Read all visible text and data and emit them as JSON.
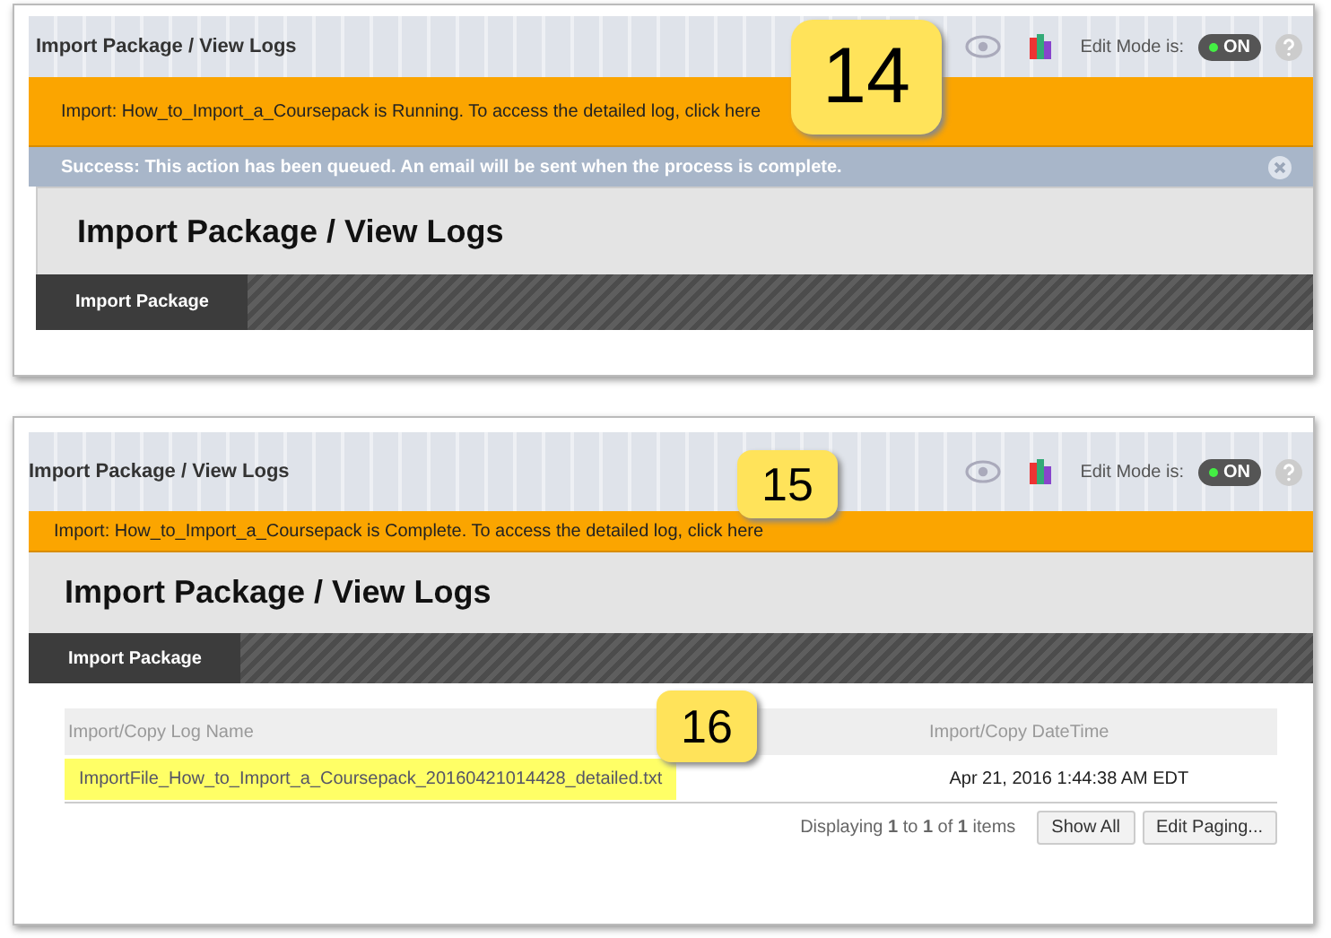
{
  "panels": [
    {
      "breadcrumb": "Import Package / View Logs",
      "edit_mode": {
        "label": "Edit Mode is:",
        "on": true,
        "text": "ON"
      },
      "callout": "14",
      "notice": "Import: How_to_Import_a_Coursepack is Running. To access the detailed log, click here",
      "success": "Success: This action has been queued. An email will be sent when the process is complete.",
      "title": "Import Package / View Logs",
      "tabs": [
        {
          "label": "Import Package",
          "selected": true
        }
      ]
    },
    {
      "breadcrumb": "Import Package / View Logs",
      "edit_mode": {
        "label": "Edit Mode is:",
        "on": true,
        "text": "ON"
      },
      "callout": "15",
      "notice": "Import: How_to_Import_a_Coursepack is Complete. To access the detailed log, click here",
      "title": "Import Package / View Logs",
      "tabs": [
        {
          "label": "Import Package",
          "selected": true
        }
      ],
      "table": {
        "callout": "16",
        "columns": [
          "Import/Copy Log Name",
          "Import/Copy DateTime"
        ],
        "rows": [
          {
            "name": "ImportFile_How_to_Import_a_Coursepack_20160421014428_detailed.txt",
            "datetime": "Apr 21, 2016 1:44:38 AM EDT",
            "highlighted": true
          }
        ],
        "paging": "Displaying **1** to **1** of **1** items",
        "buttons": [
          "Show All",
          "Edit Paging..."
        ]
      }
    }
  ]
}
